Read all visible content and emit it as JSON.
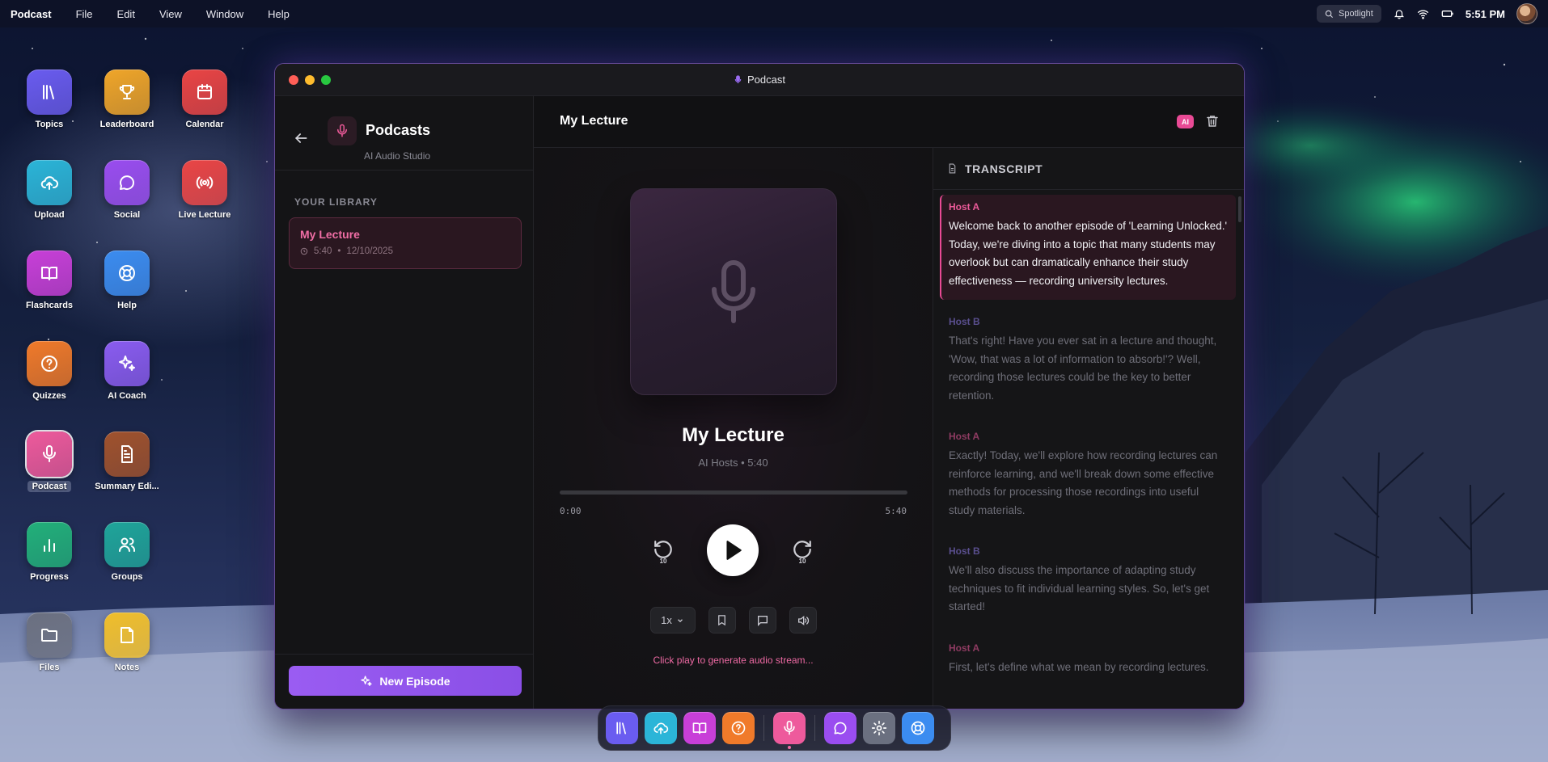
{
  "menubar": {
    "app_name": "Podcast",
    "menus": [
      "File",
      "Edit",
      "View",
      "Window",
      "Help"
    ],
    "spotlight_label": "Spotlight",
    "clock": "5:51 PM"
  },
  "desktop_icons": [
    {
      "label": "Topics",
      "icon": "library-icon",
      "color": "#6a5cf0"
    },
    {
      "label": "Leaderboard",
      "icon": "trophy-icon",
      "color": "#f0a62a"
    },
    {
      "label": "Calendar",
      "icon": "calendar-icon",
      "color": "#ea4545"
    },
    {
      "label": "Upload",
      "icon": "upload-cloud-icon",
      "color": "#2bb5d8"
    },
    {
      "label": "Social",
      "icon": "chat-bubble-icon",
      "color": "#9a4df0"
    },
    {
      "label": "Live Lecture",
      "icon": "broadcast-icon",
      "color": "#ea4545"
    },
    {
      "label": "Flashcards",
      "icon": "book-open-icon",
      "color": "#c83fd8"
    },
    {
      "label": "Help",
      "icon": "lifebuoy-icon",
      "color": "#3b8cf0"
    },
    {
      "label": "Quizzes",
      "icon": "question-circle-icon",
      "color": "#f07a2a"
    },
    {
      "label": "AI Coach",
      "icon": "sparkles-icon",
      "color": "#8a5cf0"
    },
    {
      "label": "Podcast",
      "icon": "microphone-icon",
      "color": "#ee5a9c"
    },
    {
      "label": "Summary Edi...",
      "icon": "document-icon",
      "color": "#a0522d"
    },
    {
      "label": "Progress",
      "icon": "bar-chart-icon",
      "color": "#22b07a"
    },
    {
      "label": "Groups",
      "icon": "users-icon",
      "color": "#1fa59a"
    },
    {
      "label": "Files",
      "icon": "folder-icon",
      "color": "#6b7080"
    },
    {
      "label": "Notes",
      "icon": "note-icon",
      "color": "#f0be2a"
    }
  ],
  "window": {
    "title": "Podcast",
    "sidebar": {
      "title": "Podcasts",
      "subtitle": "AI Audio Studio",
      "library_heading": "YOUR LIBRARY",
      "episodes": [
        {
          "title": "My Lecture",
          "duration": "5:40",
          "separator": "•",
          "date": "12/10/2025"
        }
      ],
      "new_episode_label": "New Episode"
    },
    "main": {
      "title": "My Lecture",
      "ai_badge": "AI",
      "player": {
        "track_title": "My Lecture",
        "track_sub": "AI Hosts • 5:40",
        "current_time": "0:00",
        "total_time": "5:40",
        "progress": 0,
        "skip_back": "10",
        "skip_forward": "10",
        "speed": "1x",
        "hint": "Click play to generate audio stream..."
      },
      "transcript": {
        "heading": "TRANSCRIPT",
        "entries": [
          {
            "speaker": "Host A",
            "text": "Welcome back to another episode of 'Learning Unlocked.' Today, we're diving into a topic that many students may overlook but can dramatically enhance their study effectiveness — recording university lectures."
          },
          {
            "speaker": "Host B",
            "text": "That's right! Have you ever sat in a lecture and thought, 'Wow, that was a lot of information to absorb!'? Well, recording those lectures could be the key to better retention."
          },
          {
            "speaker": "Host A",
            "text": "Exactly! Today, we'll explore how recording lectures can reinforce learning, and we'll break down some effective methods for processing those recordings into useful study materials."
          },
          {
            "speaker": "Host B",
            "text": "We'll also discuss the importance of adapting study techniques to fit individual learning styles. So, let's get started!"
          },
          {
            "speaker": "Host A",
            "text": "First, let's define what we mean by recording lectures."
          }
        ]
      }
    }
  },
  "colors": {
    "accent_pink": "#e94a95",
    "accent_purple": "#9a5cf2",
    "window_border": "#aa78ff"
  }
}
